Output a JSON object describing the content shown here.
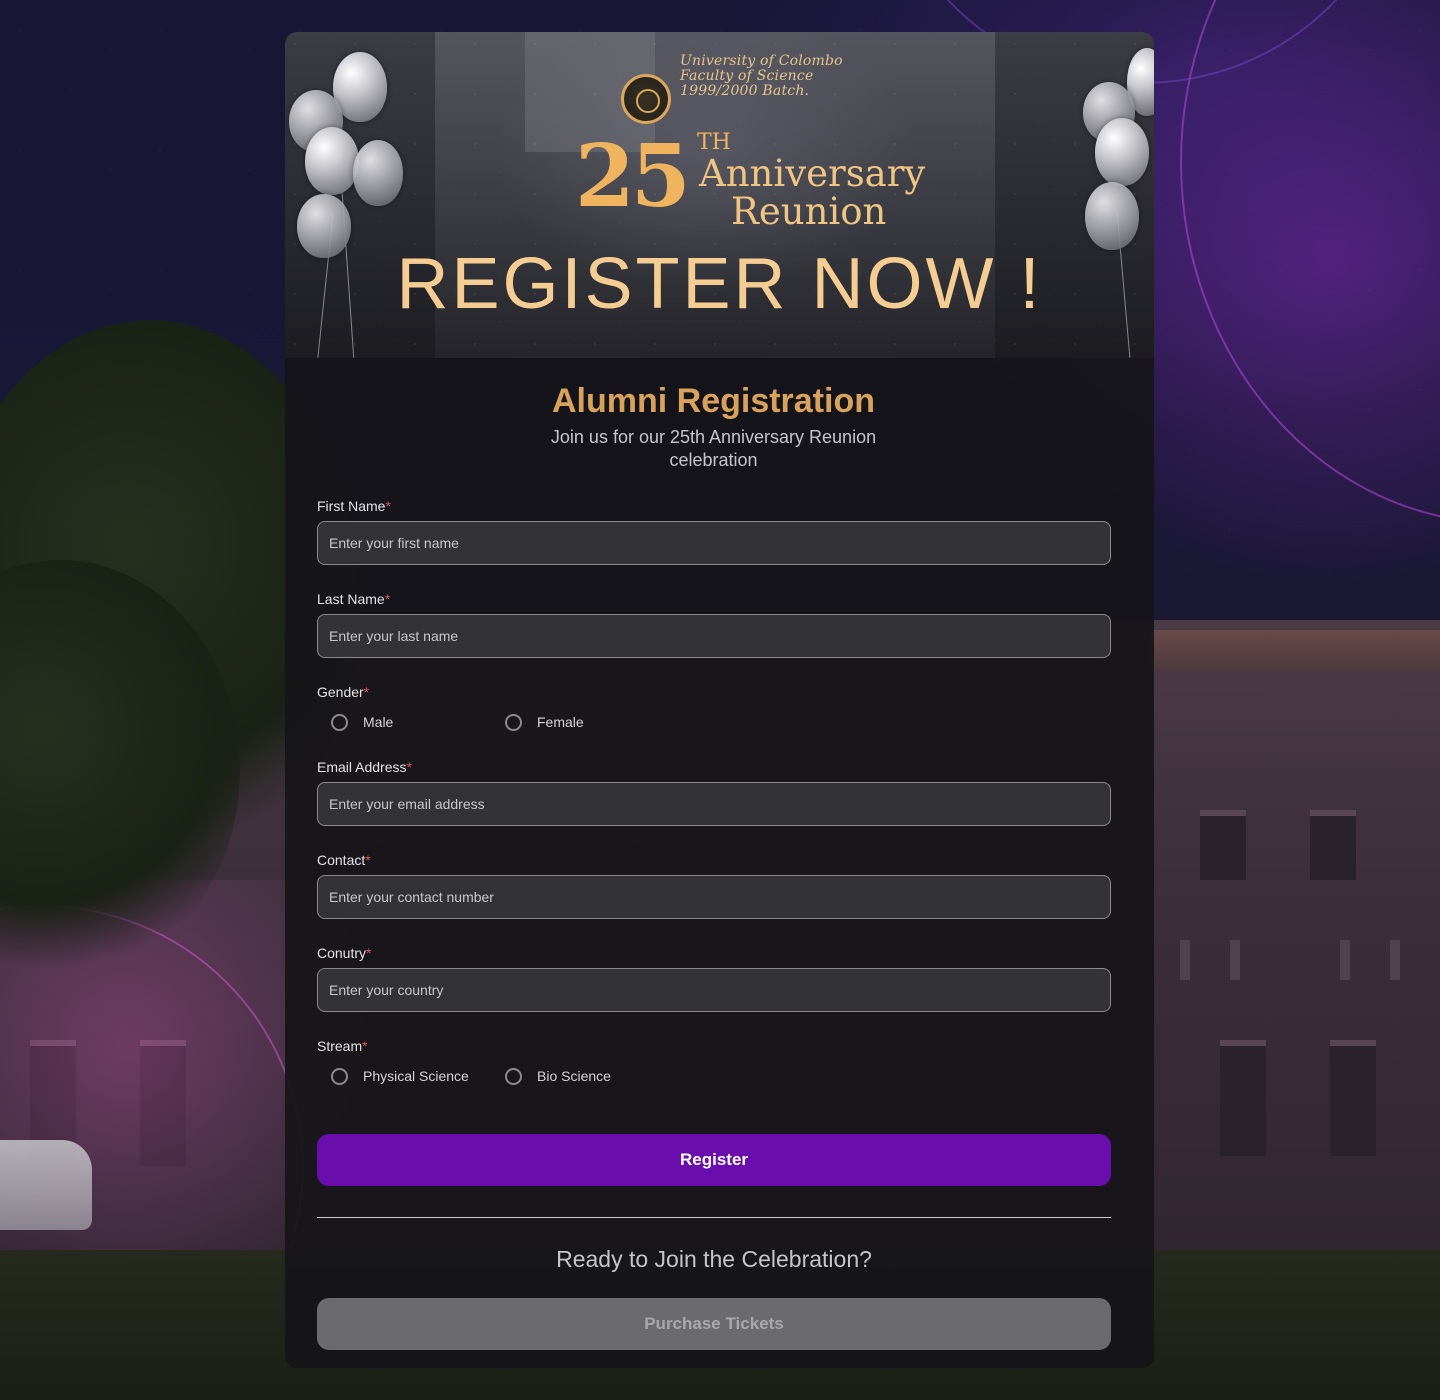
{
  "banner": {
    "university_line1": "University of Colombo",
    "university_line2": "Faculty of Science",
    "university_line3": "1999/2000 Batch.",
    "number": "25",
    "superscript": "TH",
    "anniversary": "Anniversary",
    "reunion": "Reunion",
    "headline": "REGISTER NOW !"
  },
  "form": {
    "title": "Alumni Registration",
    "subtitle": "Join us for our 25th Anniversary Reunion celebration",
    "required_mark": "*",
    "first_name": {
      "label": "First Name",
      "placeholder": "Enter your first name",
      "value": ""
    },
    "last_name": {
      "label": "Last Name",
      "placeholder": "Enter your last name",
      "value": ""
    },
    "gender": {
      "label": "Gender",
      "options": [
        "Male",
        "Female"
      ],
      "selected": null
    },
    "email": {
      "label": "Email Address",
      "placeholder": "Enter your email address",
      "value": ""
    },
    "contact": {
      "label": "Contact",
      "placeholder": "Enter your contact number",
      "value": ""
    },
    "country": {
      "label": "Conutry",
      "placeholder": "Enter your country",
      "value": ""
    },
    "stream": {
      "label": "Stream",
      "options": [
        "Physical Science",
        "Bio Science"
      ],
      "selected": null
    },
    "register_button": "Register"
  },
  "tickets": {
    "prompt": "Ready to Join the Celebration?",
    "purchase_button": "Purchase Tickets"
  },
  "colors": {
    "accent_gold": "#d8a25c",
    "primary_purple": "#6a0dad",
    "required_red": "#e05252",
    "disabled_gray": "#6b6b6d"
  }
}
